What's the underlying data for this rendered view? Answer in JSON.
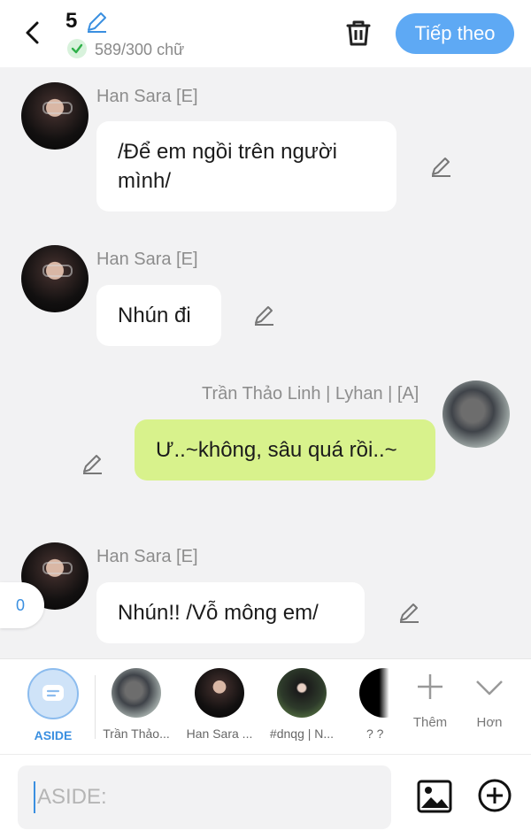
{
  "header": {
    "back_icon": "chevron-left-icon",
    "count": "5",
    "edit_icon": "pencil-icon",
    "word_count": "589/300 chữ",
    "trash_icon": "trash-icon",
    "next_label": "Tiếp theo",
    "accent": "#5ea9f4"
  },
  "messages": [
    {
      "sender": "Han Sara [E]",
      "text": "/Để em ngồi trên người mình/",
      "mine": false
    },
    {
      "sender": "Han Sara [E]",
      "text": "Nhún đi",
      "mine": false
    },
    {
      "sender": "Trần Thảo Linh | Lyhan | [A]",
      "text": "Ư..~không, sâu quá rồi..~",
      "mine": true
    },
    {
      "sender": "Han Sara [E]",
      "text": "Nhún!! /Vỗ mông em/",
      "mine": false
    }
  ],
  "side_badge": "0",
  "characters": [
    {
      "label": "ASIDE",
      "active": true
    },
    {
      "label": "Trần Thảo..."
    },
    {
      "label": "Han Sara ..."
    },
    {
      "label": "#dnqg | N..."
    },
    {
      "label": "? ?"
    }
  ],
  "actions": {
    "more_label": "Thêm",
    "expand_label": "Hơn"
  },
  "input": {
    "placeholder": "ASIDE:",
    "value": ""
  },
  "colors": {
    "my_bubble": "#d8f28c",
    "other_bubble": "#ffffff"
  }
}
